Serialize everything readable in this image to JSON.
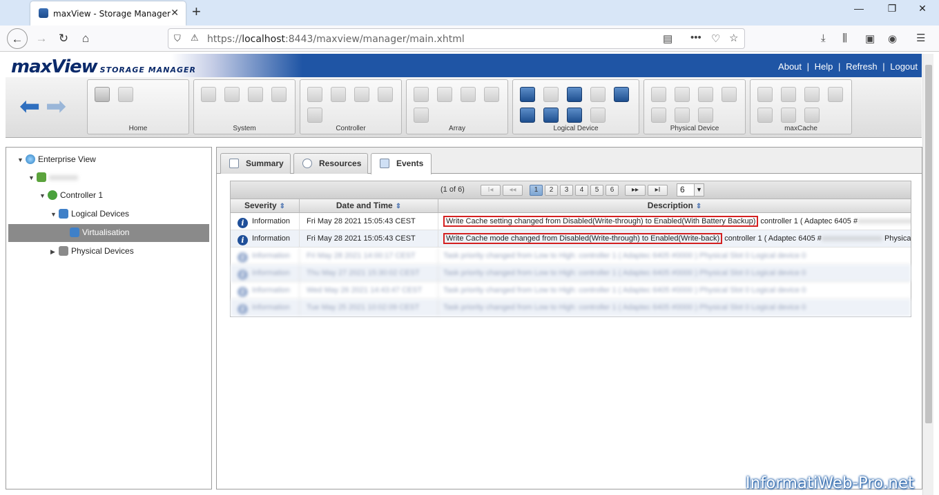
{
  "browser": {
    "tab_title": "maxView - Storage Manager",
    "url_scheme": "https://",
    "url_host": "localhost",
    "url_rest": ":8443/maxview/manager/main.xhtml"
  },
  "app": {
    "logo_main": "maxView",
    "logo_sub": "STORAGE MANAGER",
    "links": [
      "About",
      "Help",
      "Refresh",
      "Logout"
    ]
  },
  "ribbon": {
    "groups": [
      "Home",
      "System",
      "Controller",
      "Array",
      "Logical Device",
      "Physical Device",
      "maxCache"
    ]
  },
  "tree": {
    "root": "Enterprise View",
    "server": "xxxxxxx",
    "controller": "Controller 1",
    "logical": "Logical Devices",
    "selected": "Virtualisation",
    "physical": "Physical Devices"
  },
  "tabs": [
    "Summary",
    "Resources",
    "Events"
  ],
  "pager": {
    "info": "(1 of 6)",
    "first": "I◂",
    "prev": "◂◂",
    "pages": [
      "1",
      "2",
      "3",
      "4",
      "5",
      "6"
    ],
    "next": "▸▸",
    "last": "▸I",
    "page_size": "6"
  },
  "columns": [
    "Severity",
    "Date and Time",
    "Description"
  ],
  "events": [
    {
      "severity": "Information",
      "datetime": "Fri May 28 2021 15:05:43 CEST",
      "highlight": "Write Cache setting changed from Disabled(Write-through) to Enabled(With Battery Backup)",
      "rest": " controller 1 ( Adaptec 6405 #",
      "masked": "xxxxxxxxxxxxxxxx"
    },
    {
      "severity": "Information",
      "datetime": "Fri May 28 2021 15:05:43 CEST",
      "highlight": "Write Cache mode changed from Disabled(Write-through) to Enabled(Write-back)",
      "rest": " controller 1 ( Adaptec 6405 #",
      "masked": "xxxxxxxxxxxxxxxx",
      "tail": " Physical ..."
    }
  ],
  "blurred_rows": [
    {
      "severity": "Information",
      "datetime": "Fri May 28 2021 14:00:17 CEST",
      "desc": "Task priority changed from Low to High: controller 1 ( Adaptec 6405 #0000 ) Physical Slot 0 Logical device 0"
    },
    {
      "severity": "Information",
      "datetime": "Thu May 27 2021 15:30:02 CEST",
      "desc": "Task priority changed from Low to High: controller 1 ( Adaptec 6405 #0000 ) Physical Slot 0 Logical device 0"
    },
    {
      "severity": "Information",
      "datetime": "Wed May 26 2021 14:43:47 CEST",
      "desc": "Task priority changed from Low to High: controller 1 ( Adaptec 6405 #0000 ) Physical Slot 0 Logical device 0"
    },
    {
      "severity": "Information",
      "datetime": "Tue May 25 2021 10:02:09 CEST",
      "desc": "Task priority changed from Low to High: controller 1 ( Adaptec 6405 #0000 ) Physical Slot 0 Logical device 0"
    }
  ],
  "watermark": "InformatiWeb-Pro.net"
}
